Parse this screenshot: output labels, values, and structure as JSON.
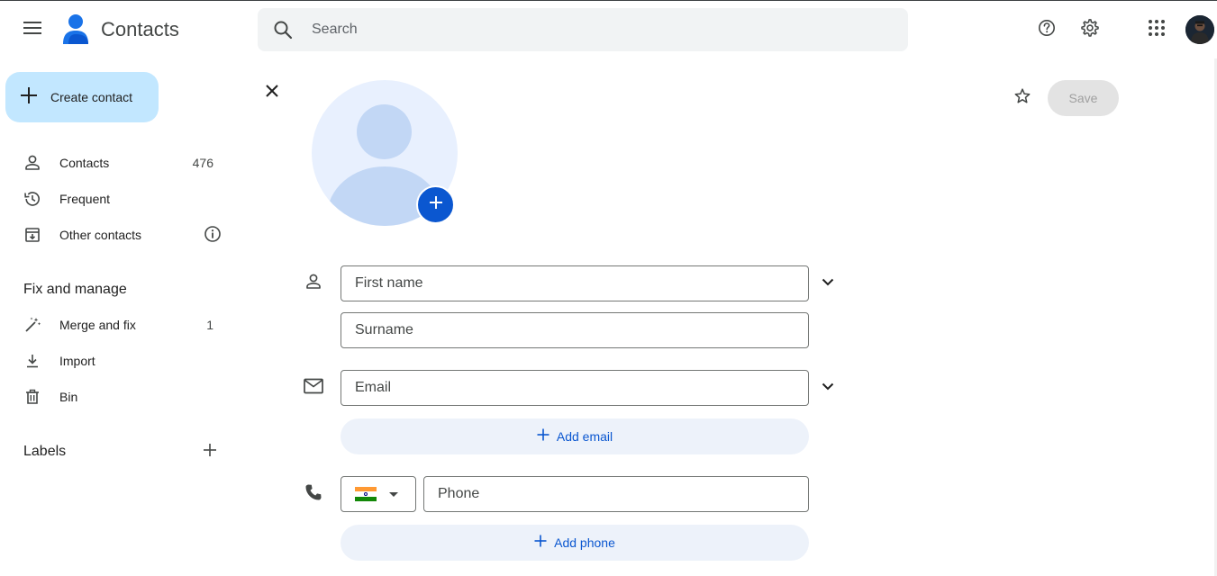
{
  "header": {
    "app_title": "Contacts",
    "search_placeholder": "Search",
    "icons": [
      "menu-icon",
      "contacts-logo-icon",
      "search-icon",
      "help-icon",
      "settings-icon",
      "apps-grid-icon"
    ]
  },
  "sidebar": {
    "create_label": "Create contact",
    "items": [
      {
        "label": "Contacts",
        "count": "476",
        "icon": "person-icon"
      },
      {
        "label": "Frequent",
        "count": "",
        "icon": "history-icon"
      },
      {
        "label": "Other contacts",
        "count": "",
        "icon": "archive-download-icon"
      }
    ],
    "fix_manage_title": "Fix and manage",
    "fix_items": [
      {
        "label": "Merge and fix",
        "count": "1",
        "icon": "magic-wand-icon"
      },
      {
        "label": "Import",
        "count": "",
        "icon": "download-icon"
      },
      {
        "label": "Bin",
        "count": "",
        "icon": "trash-icon"
      }
    ],
    "labels_title": "Labels"
  },
  "form": {
    "first_name_placeholder": "First name",
    "surname_placeholder": "Surname",
    "email_placeholder": "Email",
    "add_email_label": "Add email",
    "phone_placeholder": "Phone",
    "add_phone_label": "Add phone",
    "phone_country": "India",
    "save_label": "Save"
  },
  "colors": {
    "accent": "#0b57d0",
    "create_button_bg": "#c2e7ff",
    "search_bg": "#f1f3f4"
  }
}
